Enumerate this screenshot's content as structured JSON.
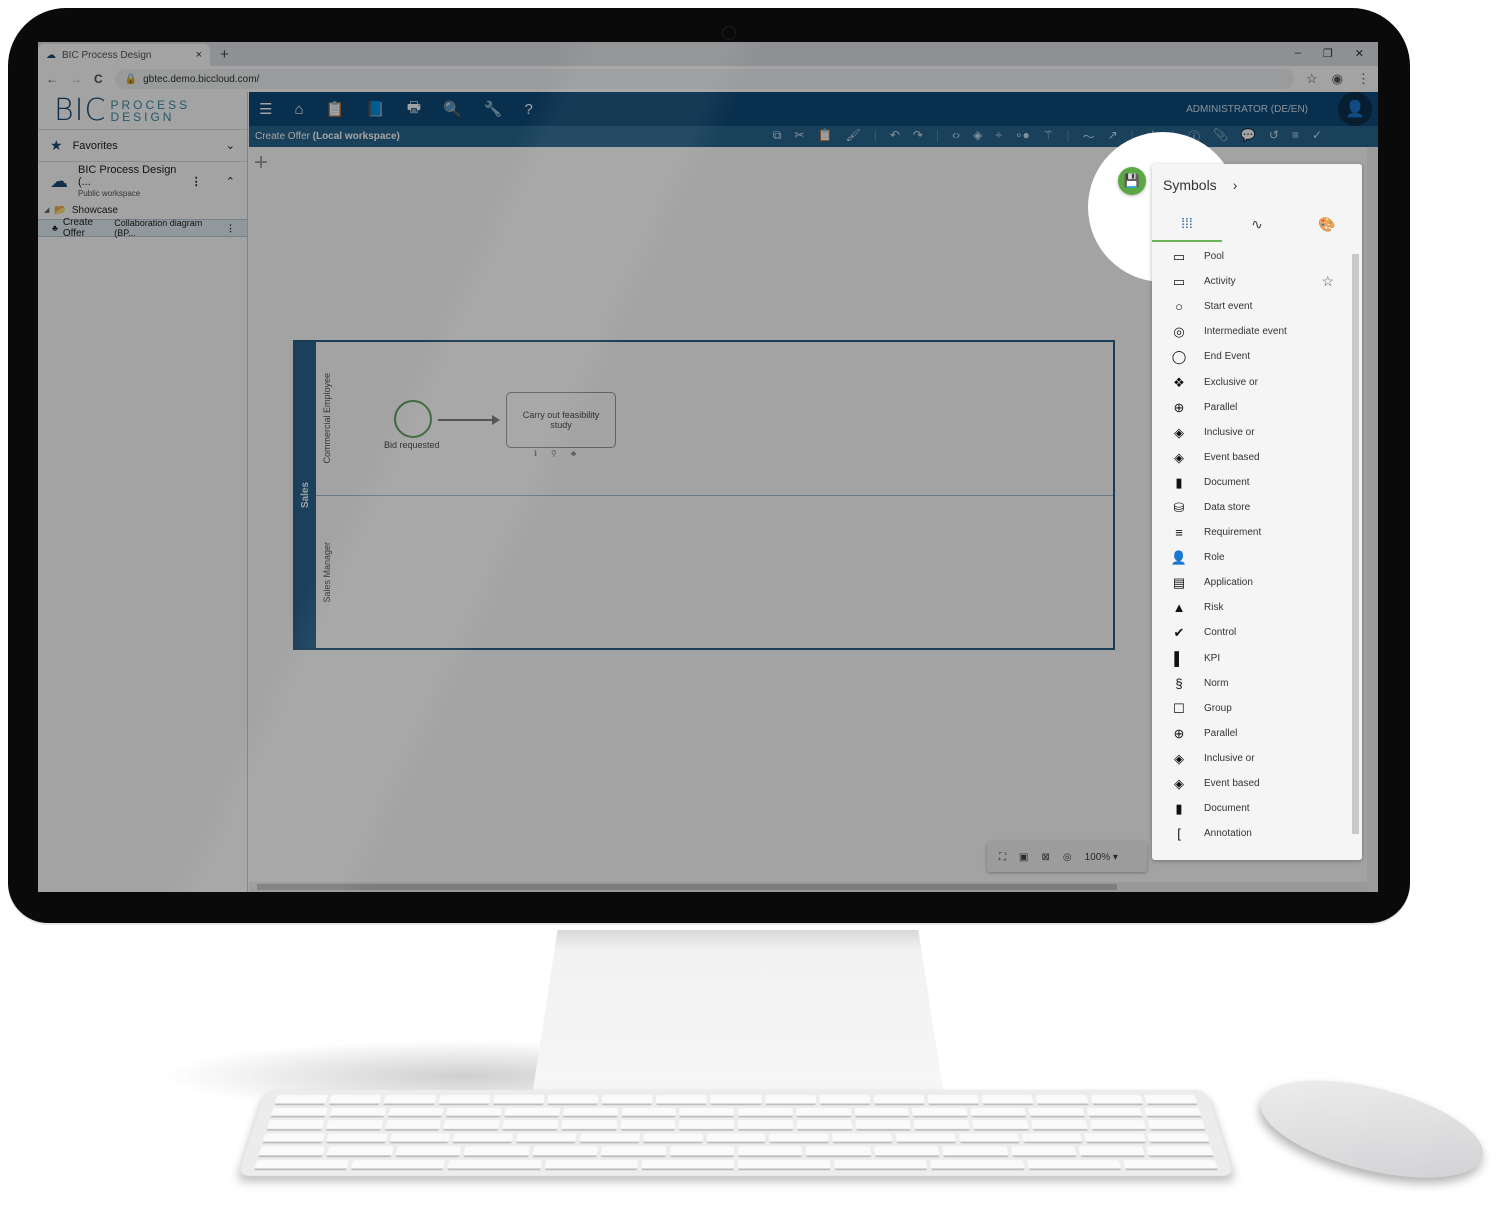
{
  "browser": {
    "tab_title": "BIC Process Design",
    "tab_close": "×",
    "new_tab": "+",
    "window_controls": [
      "–",
      "❐",
      "✕"
    ],
    "url": "gbtec.demo.biccloud.com/",
    "nav": {
      "back": "←",
      "forward": "→",
      "reload": "C"
    }
  },
  "app": {
    "logo": {
      "main": "BIC",
      "line1": "PROCESS",
      "line2": "DESIGN"
    },
    "sidebar": {
      "favorites": "Favorites",
      "workspace": {
        "name": "BIC Process Design (...",
        "sub": "Public workspace"
      },
      "folder": "Showcase",
      "diagram": {
        "name": "Create Offer",
        "type": "Collaboration diagram (BP..."
      }
    },
    "topbar": {
      "icons": [
        "menu-icon",
        "home-icon",
        "clipboard-icon",
        "book-icon",
        "print-icon",
        "search-icon",
        "wrench-icon",
        "help-icon"
      ],
      "user": "ADMINISTRATOR (DE/EN)"
    },
    "subbar": {
      "title": "Create Offer",
      "workspace": "(Local workspace)"
    },
    "canvas": {
      "pool": "Sales",
      "lanes": [
        "Commercial Employee",
        "Sales Manager"
      ],
      "start_event": "Bid requested",
      "task": "Carry out feasibility study"
    },
    "zoom": {
      "level": "100%"
    },
    "symbols_panel": {
      "title": "Symbols",
      "items": [
        {
          "label": "Pool",
          "icon": "▭"
        },
        {
          "label": "Activity",
          "icon": "▭",
          "favorite": true
        },
        {
          "label": "Start event",
          "icon": "○"
        },
        {
          "label": "Intermediate event",
          "icon": "◎"
        },
        {
          "label": "End Event",
          "icon": "◯"
        },
        {
          "label": "Exclusive or",
          "icon": "❖"
        },
        {
          "label": "Parallel",
          "icon": "⊕"
        },
        {
          "label": "Inclusive or",
          "icon": "◈"
        },
        {
          "label": "Event based",
          "icon": "◈"
        },
        {
          "label": "Document",
          "icon": "▮"
        },
        {
          "label": "Data store",
          "icon": "⛁"
        },
        {
          "label": "Requirement",
          "icon": "≡"
        },
        {
          "label": "Role",
          "icon": "👤"
        },
        {
          "label": "Application",
          "icon": "▤"
        },
        {
          "label": "Risk",
          "icon": "▲"
        },
        {
          "label": "Control",
          "icon": "✔"
        },
        {
          "label": "KPI",
          "icon": "▌"
        },
        {
          "label": "Norm",
          "icon": "§"
        },
        {
          "label": "Group",
          "icon": "☐"
        },
        {
          "label": "Parallel",
          "icon": "⊕"
        },
        {
          "label": "Inclusive or",
          "icon": "◈"
        },
        {
          "label": "Event based",
          "icon": "◈"
        },
        {
          "label": "Document",
          "icon": "▮"
        },
        {
          "label": "Annotation",
          "icon": "["
        }
      ]
    }
  }
}
